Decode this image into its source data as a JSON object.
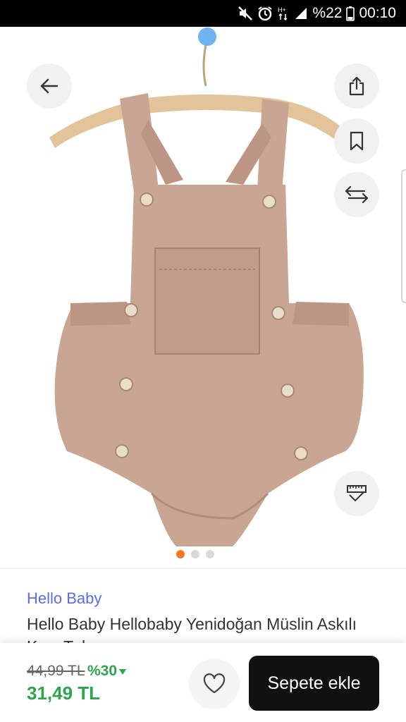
{
  "status_bar": {
    "icons": [
      "mute-icon",
      "alarm-icon",
      "data-arrows-icon",
      "signal-icon",
      "battery-icon"
    ],
    "battery": "%22",
    "time": "00:10"
  },
  "product": {
    "brand": "Hello Baby",
    "title": "Hello Baby Hellobaby Yenidoğan Müslin Askılı Kısa Tulum",
    "image_count": 3,
    "active_image": 1
  },
  "price": {
    "old": "44,99 TL",
    "discount": "%30",
    "current": "31,49 TL"
  },
  "actions": {
    "add_to_cart": "Sepete ekle"
  },
  "colors": {
    "brand_link": "#5b6de0",
    "price_green": "#2ea44f",
    "active_dot": "#f27a1a",
    "cart_button": "#111111",
    "garment": "#c9a593"
  }
}
